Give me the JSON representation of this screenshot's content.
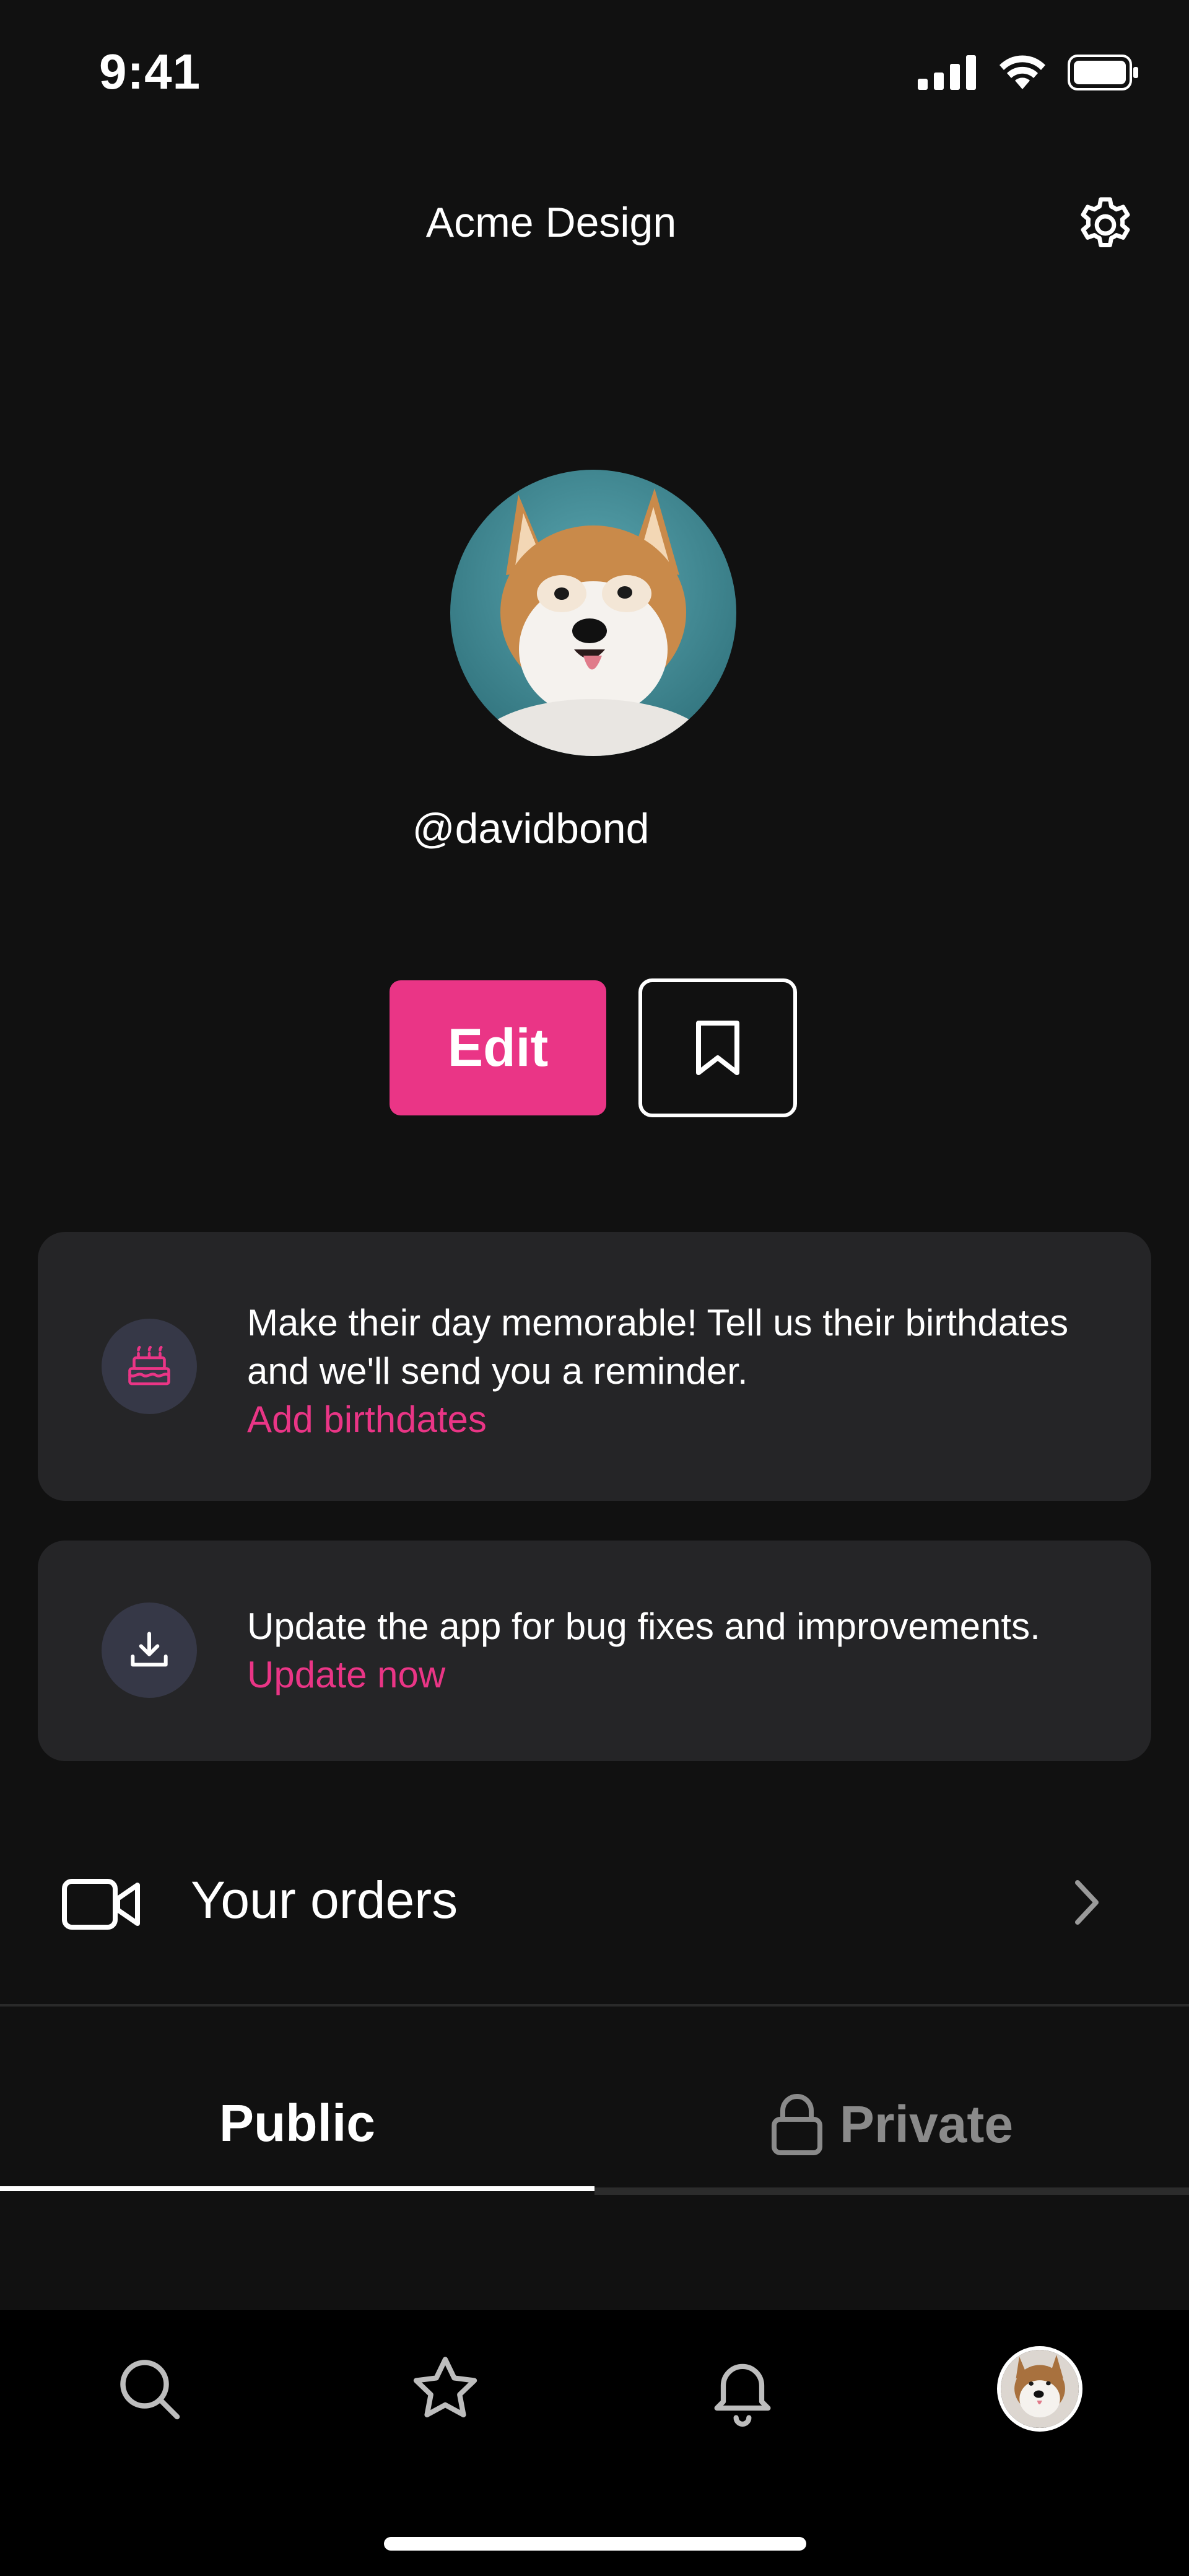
{
  "status_bar": {
    "time": "9:41",
    "icons": [
      "signal-icon",
      "wifi-icon",
      "battery-icon"
    ]
  },
  "header": {
    "title": "Acme Design",
    "settings_icon": "gear-icon"
  },
  "profile": {
    "username": "@davidbond",
    "avatar": "dog-avatar"
  },
  "actions": {
    "edit_label": "Edit",
    "bookmark_icon": "bookmark-icon"
  },
  "cards": [
    {
      "icon": "birthday-cake-icon",
      "text": "Make their day memorable! Tell us their birthdates and we'll send you a reminder.",
      "link": "Add birthdates"
    },
    {
      "icon": "download-icon",
      "text": "Update the app for bug fixes and improvements.",
      "link": "Update now"
    }
  ],
  "orders": {
    "label": "Your orders",
    "icon": "video-camera-icon"
  },
  "tabs": [
    {
      "label": "Public",
      "active": true
    },
    {
      "label": "Private",
      "active": false,
      "icon": "lock-icon"
    }
  ],
  "bottom_nav": {
    "items": [
      "search-icon",
      "star-icon",
      "bell-icon",
      "profile-avatar"
    ]
  },
  "colors": {
    "accent": "#EA3586",
    "background": "#111111",
    "card": "#252527",
    "nav": "#000000"
  }
}
